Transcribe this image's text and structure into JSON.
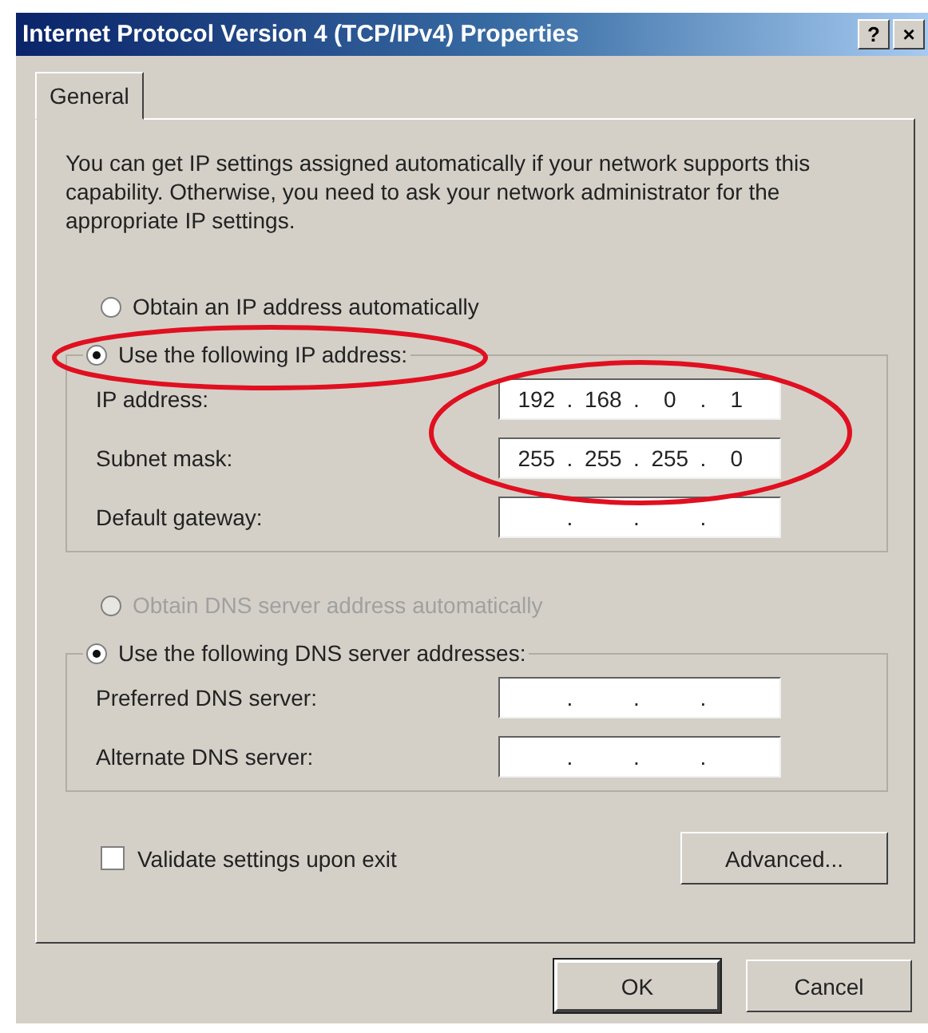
{
  "window": {
    "title": "Internet Protocol Version 4 (TCP/IPv4) Properties",
    "title_buttons": [
      "?",
      "×"
    ]
  },
  "tabs": [
    {
      "label": "General",
      "selected": true
    }
  ],
  "description": "You can get IP settings assigned automatically if your network supports this capability. Otherwise, you need to ask your network administrator for the appropriate IP settings.",
  "ip_separator": ".",
  "ip_mode": [
    {
      "label": "Obtain an IP address automatically",
      "selected": false,
      "disabled": false
    },
    {
      "label": "Use the following IP address:",
      "selected": true,
      "disabled": false
    }
  ],
  "ip_fields": [
    {
      "label": "IP address:",
      "octets": [
        "192",
        "168",
        "0",
        "1"
      ]
    },
    {
      "label": "Subnet mask:",
      "octets": [
        "255",
        "255",
        "255",
        "0"
      ]
    },
    {
      "label": "Default gateway:"
    }
  ],
  "dns_mode": [
    {
      "label": "Obtain DNS server address automatically",
      "selected": false,
      "disabled": true
    },
    {
      "label": "Use the following DNS server addresses:",
      "selected": true,
      "disabled": false
    }
  ],
  "dns_fields": [
    {
      "label": "Preferred DNS server:"
    },
    {
      "label": "Alternate DNS server:"
    }
  ],
  "validate": {
    "label": "Validate settings upon exit",
    "checked": false
  },
  "advanced_button": "Advanced...",
  "buttons": [
    {
      "label": "OK",
      "default": true
    },
    {
      "label": "Cancel",
      "default": false
    }
  ],
  "highlight_ip_mode": true,
  "highlight_ip_values": true
}
